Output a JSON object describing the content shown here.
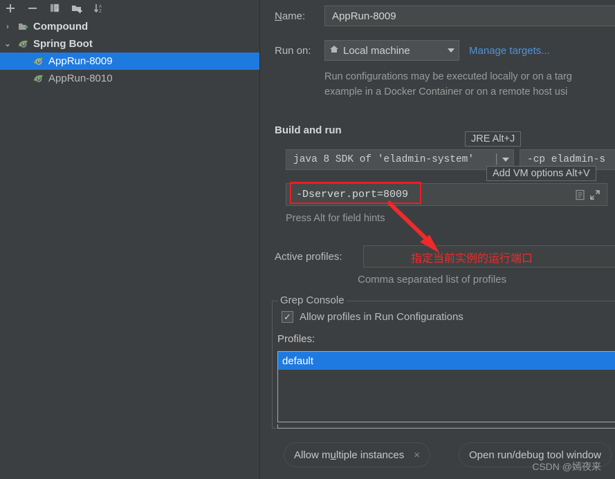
{
  "sidebar": {
    "toolbar": [
      {
        "name": "add-button",
        "icon": "plus-icon",
        "label": "+"
      },
      {
        "name": "remove-button",
        "icon": "minus-icon",
        "label": "−"
      },
      {
        "name": "copy-button",
        "icon": "copy-icon",
        "label": "Copy Configuration"
      },
      {
        "name": "new-folder-button",
        "icon": "folder-add-icon",
        "label": "Create New Folder"
      },
      {
        "name": "sort-button",
        "icon": "sort-alphabetical-icon",
        "label": "Sort Configurations"
      }
    ],
    "tree": [
      {
        "label": "Compound",
        "icon": "compound-folder-icon",
        "arrow": "›",
        "level": 0,
        "selected": false
      },
      {
        "label": "Spring Boot",
        "icon": "spring-boot-icon",
        "arrow": "⌄",
        "level": 0,
        "selected": false
      },
      {
        "label": "AppRun-8009",
        "icon": "spring-boot-run-icon",
        "arrow": "",
        "level": 1,
        "selected": true
      },
      {
        "label": "AppRun-8010",
        "icon": "spring-boot-run-icon",
        "arrow": "",
        "level": 1,
        "selected": false
      }
    ]
  },
  "form": {
    "name_label": "Name:",
    "name_mnemonic": "N",
    "name_rest": "ame:",
    "name_value": "AppRun-8009",
    "run_on_label": "Run on:",
    "target_value": "Local machine",
    "manage_targets_label": "Manage targets...",
    "target_description_line1": "Run configurations may be executed locally or on a targ",
    "target_description_line2": "example in a Docker Container or on a remote host usi",
    "build_and_run_title": "Build and run",
    "jdk_value": "java 8 SDK of 'eladmin-system'",
    "jdk_trailing": "│",
    "classpath_value": "-cp eladmin-s",
    "tooltip_jre": "JRE Alt+J",
    "tooltip_vm_options": "Add VM options Alt+V",
    "vm_options_value": "-Dserver.port=8009",
    "alt_hint": "Press Alt for field hints",
    "active_profiles_label": "Active profiles:",
    "active_profiles_value": "",
    "active_profiles_hint": "Comma separated list of profiles"
  },
  "grep_console": {
    "legend": "Grep Console",
    "allow_profiles_label": "Allow profiles in Run Configurations",
    "allow_profiles_checked": true,
    "checkmark": "✓",
    "profiles_label": "Profiles:",
    "profiles_items": [
      {
        "label": "default",
        "selected": true
      }
    ]
  },
  "bottom": {
    "allow_multiple_prefix": "Allow m",
    "allow_multiple_mnemonic": "u",
    "allow_multiple_suffix": "ltiple instances",
    "chip_close": "×",
    "open_tool_window_label": "Open run/debug tool window"
  },
  "annotations": {
    "highlight_box_target": "-Dserver.port=8009",
    "note_text": "指定当前实例的运行端口",
    "note_color": "#f02a2a",
    "box_color": "#ee1c25"
  },
  "watermark": {
    "text": "CSDN @嫣夜来"
  },
  "colors": {
    "background": "#3c3f41",
    "selection_blue": "#1f7ae0",
    "link_blue": "#4e93d9",
    "text_primary": "#c6c6c6",
    "text_muted": "#9a9a9a",
    "annotation_red": "#f02a2a"
  }
}
